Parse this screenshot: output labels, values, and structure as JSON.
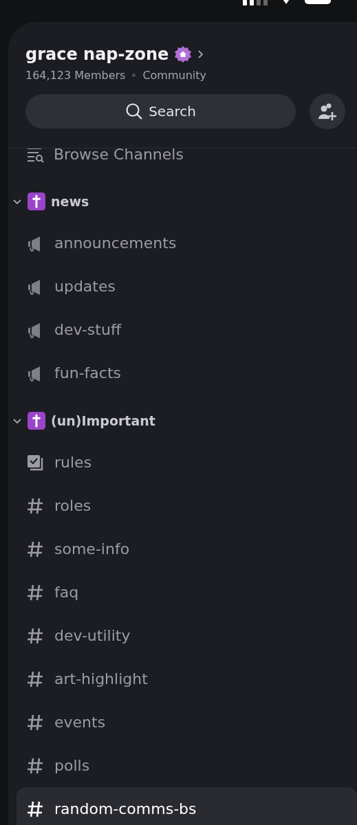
{
  "server": {
    "name": "grace nap-zone",
    "members": "164,123 Members",
    "type": "Community"
  },
  "search": {
    "label": "Search"
  },
  "browse": {
    "label": "Browse Channels"
  },
  "categories": [
    {
      "name": "news",
      "expanded": true,
      "channels": [
        {
          "name": "announcements",
          "kind": "announcement",
          "selected": false
        },
        {
          "name": "updates",
          "kind": "announcement",
          "selected": false
        },
        {
          "name": "dev-stuff",
          "kind": "announcement",
          "selected": false
        },
        {
          "name": "fun-facts",
          "kind": "announcement",
          "selected": false
        }
      ]
    },
    {
      "name": "(un)Important",
      "expanded": true,
      "channels": [
        {
          "name": "rules",
          "kind": "rules",
          "selected": false
        },
        {
          "name": "roles",
          "kind": "text",
          "selected": false
        },
        {
          "name": "some-info",
          "kind": "text",
          "selected": false
        },
        {
          "name": "faq",
          "kind": "text",
          "selected": false
        },
        {
          "name": "dev-utility",
          "kind": "text",
          "selected": false
        },
        {
          "name": "art-highlight",
          "kind": "text",
          "selected": false
        },
        {
          "name": "events",
          "kind": "text",
          "selected": false
        },
        {
          "name": "polls",
          "kind": "text",
          "selected": false
        },
        {
          "name": "random-comms-bs",
          "kind": "text",
          "selected": true
        }
      ]
    }
  ]
}
